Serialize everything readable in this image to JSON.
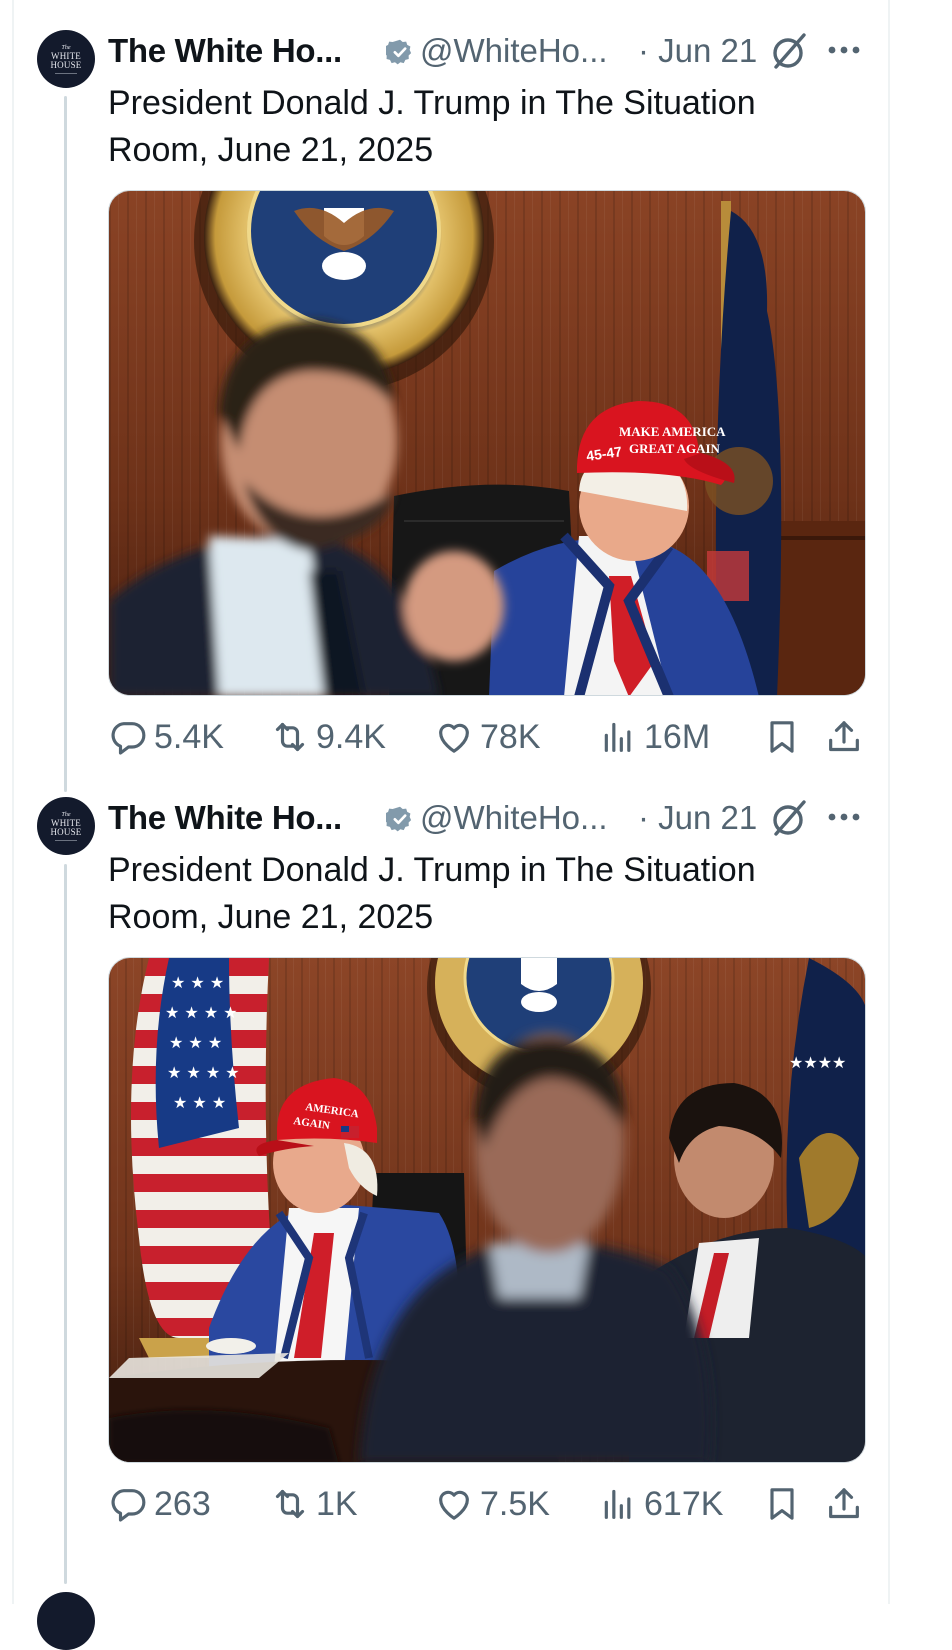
{
  "thread": [
    {
      "author": {
        "avatar_lines": [
          "The",
          "WHITE",
          "HOUSE"
        ],
        "name": "The White Ho...",
        "verified_icon": "verified-badge-icon",
        "handle": "@WhiteHo...",
        "date": "· Jun 21"
      },
      "text": "President Donald J. Trump in The Situation Room, June 21, 2025",
      "media": {
        "hat_text": "MAKE AMERICA GREAT AGAIN 45-47",
        "seal_text": "SEAL OF THE PRESIDENT OF THE UNITED STATES"
      },
      "metrics": {
        "replies": "5.4K",
        "reposts": "9.4K",
        "likes": "78K",
        "views": "16M"
      }
    },
    {
      "author": {
        "avatar_lines": [
          "The",
          "WHITE",
          "HOUSE"
        ],
        "name": "The White Ho...",
        "verified_icon": "verified-badge-icon",
        "handle": "@WhiteHo...",
        "date": "· Jun 21"
      },
      "text": "President Donald J. Trump in The Situation Room, June 21, 2025",
      "media": {
        "hat_text": "AMERICA AGAIN",
        "seal_text": "SEAL OF THE PRESIDENT OF THE UNITED STATES"
      },
      "metrics": {
        "replies": "263",
        "reposts": "1K",
        "likes": "7.5K",
        "views": "617K"
      }
    }
  ],
  "colors": {
    "text_primary": "#0f1419",
    "text_secondary": "#536471",
    "thread_line": "#cfd9de",
    "verified_badge": "#829aab",
    "avatar_bg": "#131a2c"
  }
}
